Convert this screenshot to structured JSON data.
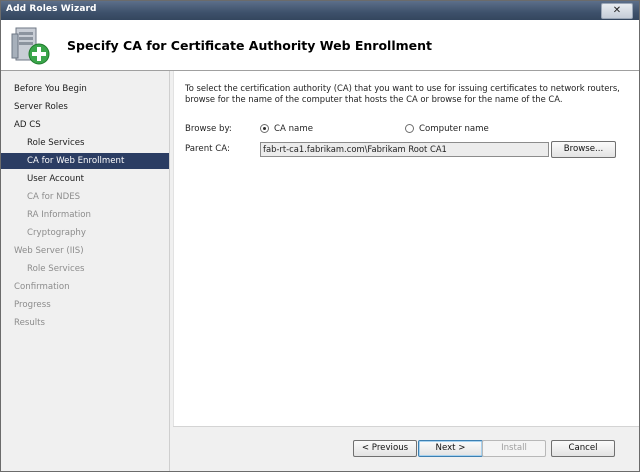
{
  "window": {
    "title": "Add Roles Wizard",
    "close_glyph": "✕"
  },
  "header": {
    "title": "Specify CA for Certificate Authority Web Enrollment",
    "icon": "server-add-icon"
  },
  "nav": {
    "items": [
      {
        "label": "Before You Begin"
      },
      {
        "label": "Server Roles"
      },
      {
        "label": "AD CS"
      },
      {
        "label": "Role Services"
      },
      {
        "label": "CA for Web Enrollment"
      },
      {
        "label": "User Account"
      },
      {
        "label": "CA for NDES"
      },
      {
        "label": "RA Information"
      },
      {
        "label": "Cryptography"
      },
      {
        "label": "Web Server (IIS)"
      },
      {
        "label": "Role Services"
      },
      {
        "label": "Confirmation"
      },
      {
        "label": "Progress"
      },
      {
        "label": "Results"
      }
    ]
  },
  "main": {
    "description": "To select the certification authority (CA) that you want to use for issuing certificates to network routers, browse for the name of the computer that hosts the CA or browse for the name of the CA.",
    "browse_by_label": "Browse by:",
    "option_ca_name": "CA name",
    "option_computer_name": "Computer name",
    "selected_option": "CA name",
    "parent_ca_label": "Parent CA:",
    "parent_ca_value": "fab-rt-ca1.fabrikam.com\\Fabrikam Root CA1",
    "browse_button": "Browse..."
  },
  "footer": {
    "previous": "< Previous",
    "next": "Next >",
    "install": "Install",
    "cancel": "Cancel"
  },
  "colors": {
    "nav_selected": "#2b3d63",
    "titlebar": "#3e516b"
  }
}
